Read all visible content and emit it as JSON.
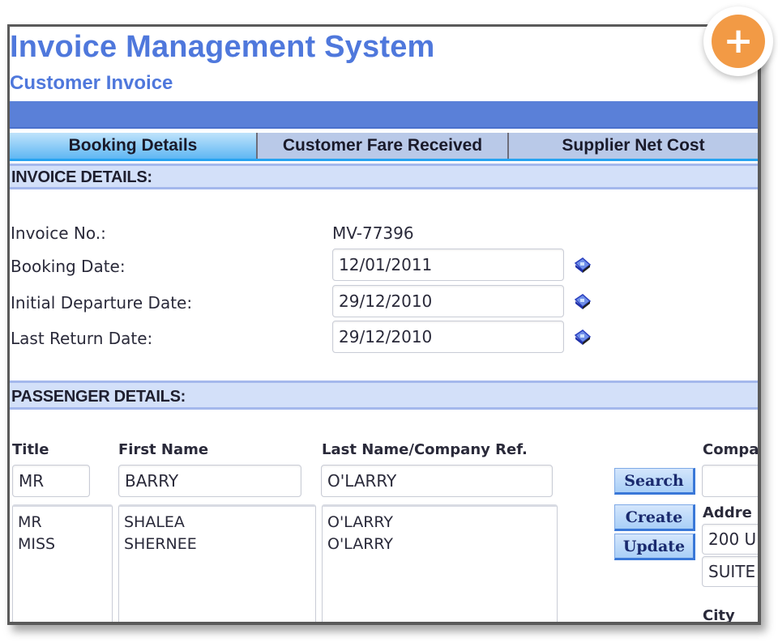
{
  "app": {
    "title": "Invoice Management System",
    "subtitle": "Customer Invoice",
    "accent_color": "#5a80d8",
    "add_button_color": "#f29a45",
    "add_button_icon": "plus-icon"
  },
  "tabs": [
    {
      "label": "Booking Details",
      "active": true
    },
    {
      "label": "Customer Fare Received",
      "active": false
    },
    {
      "label": "Supplier Net Cost",
      "active": false
    }
  ],
  "invoice_details": {
    "section_title": "INVOICE DETAILS:",
    "invoice_no_label": "Invoice No.:",
    "invoice_no_value": "MV-77396",
    "booking_date_label": "Booking Date:",
    "booking_date_value": "12/01/2011",
    "initial_departure_label": "Initial Departure Date:",
    "initial_departure_value": "29/12/2010",
    "last_return_label": "Last Return Date:",
    "last_return_value": "29/12/2010",
    "calendar_icon": "calendar-icon"
  },
  "passenger_details": {
    "section_title": "PASSENGER DETAILS:",
    "columns": {
      "title": "Title",
      "first_name": "First Name",
      "last_name": "Last Name/Company Ref.",
      "company": "Compa",
      "address": "Addre",
      "city": "City"
    },
    "input": {
      "title": "MR",
      "first_name": "BARRY",
      "last_name": "O'LARRY",
      "company": "",
      "address_line1": "200 U",
      "address_line2": "SUITE"
    },
    "list": [
      {
        "title": "MR",
        "first_name": "SHALEA",
        "last_name": "O'LARRY"
      },
      {
        "title": "MISS",
        "first_name": "SHERNEE",
        "last_name": "O'LARRY"
      }
    ],
    "buttons": {
      "search": "Search",
      "create": "Create",
      "update": "Update"
    }
  }
}
